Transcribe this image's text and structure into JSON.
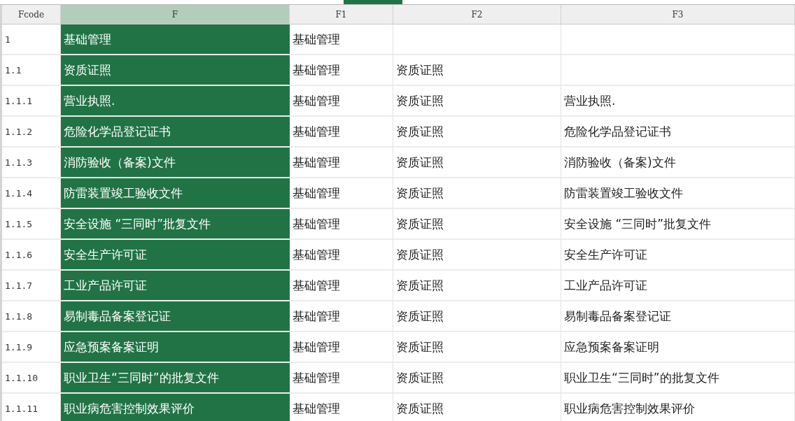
{
  "columns": [
    {
      "label": "Fcode",
      "selected": false
    },
    {
      "label": "F",
      "selected": true
    },
    {
      "label": "F1",
      "selected": false
    },
    {
      "label": "F2",
      "selected": false
    },
    {
      "label": "F3",
      "selected": false
    }
  ],
  "rows": [
    {
      "cells": [
        "1",
        "基础管理",
        "基础管理",
        "",
        ""
      ]
    },
    {
      "cells": [
        "1.1",
        "资质证照",
        "基础管理",
        "资质证照",
        ""
      ]
    },
    {
      "cells": [
        "1.1.1",
        "营业执照.",
        "基础管理",
        "资质证照",
        "营业执照."
      ]
    },
    {
      "cells": [
        "1.1.2",
        "危险化学品登记证书",
        "基础管理",
        "资质证照",
        "危险化学品登记证书"
      ]
    },
    {
      "cells": [
        "1.1.3",
        "消防验收（备案)文件",
        "基础管理",
        "资质证照",
        "消防验收（备案)文件"
      ]
    },
    {
      "cells": [
        "1.1.4",
        "防雷装置竣工验收文件",
        "基础管理",
        "资质证照",
        "防雷装置竣工验收文件"
      ]
    },
    {
      "cells": [
        "1.1.5",
        "安全设施 “三同时”批复文件",
        "基础管理",
        "资质证照",
        "安全设施 “三同时”批复文件"
      ]
    },
    {
      "cells": [
        "1.1.6",
        "安全生产许可证",
        "基础管理",
        "资质证照",
        "安全生产许可证"
      ]
    },
    {
      "cells": [
        "1.1.7",
        "工业产品许可证",
        "基础管理",
        "资质证照",
        "工业产品许可证"
      ]
    },
    {
      "cells": [
        "1.1.8",
        "易制毒品备案登记证",
        "基础管理",
        "资质证照",
        "易制毒品备案登记证"
      ]
    },
    {
      "cells": [
        "1.1.9",
        "应急预案备案证明",
        "基础管理",
        "资质证照",
        "应急预案备案证明"
      ]
    },
    {
      "cells": [
        "1.1.10",
        "职业卫生“三同时”的批复文件",
        "基础管理",
        "资质证照",
        "职业卫生“三同时”的批复文件"
      ]
    },
    {
      "cells": [
        "1.1.11",
        "职业病危害控制效果评价",
        "基础管理",
        "资质证照",
        "职业病危害控制效果评价"
      ]
    }
  ]
}
